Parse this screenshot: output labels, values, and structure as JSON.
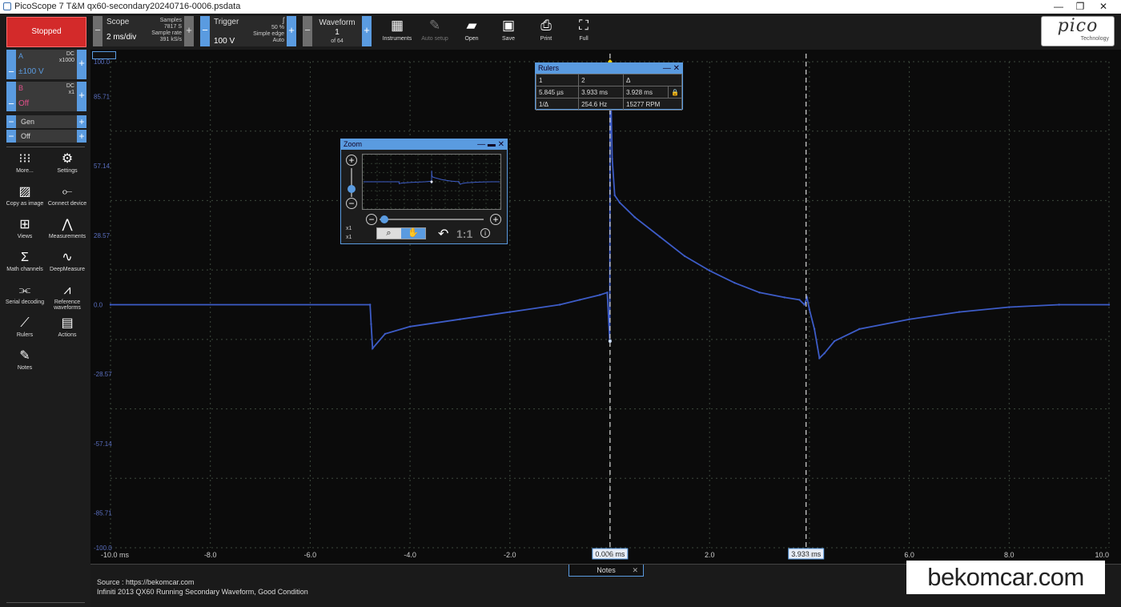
{
  "window": {
    "title": "PicoScope 7 T&M qx60-secondary20240716-0006.psdata",
    "min": "—",
    "restore": "❐",
    "close": "✕"
  },
  "toolbar": {
    "run_state": "Stopped",
    "scope": {
      "label": "Scope",
      "value": "2 ms/div",
      "samples_label": "Samples",
      "samples": "7817 S",
      "rate_label": "Sample rate",
      "rate": "391 kS/s"
    },
    "trigger": {
      "label": "Trigger",
      "value": "100 V",
      "level": "50 %",
      "type": "Simple edge",
      "mode": "Auto",
      "glyph": "ʃ"
    },
    "waveform": {
      "label": "Waveform",
      "value": "1",
      "of": "of 64"
    },
    "buttons": [
      {
        "label": "Instruments",
        "glyph": "▦"
      },
      {
        "label": "Auto setup",
        "glyph": "✎"
      },
      {
        "label": "Open",
        "glyph": "▰"
      },
      {
        "label": "Save",
        "glyph": "▣"
      },
      {
        "label": "Print",
        "glyph": "⎙"
      },
      {
        "label": "Full",
        "glyph": "⛶"
      }
    ],
    "logo": {
      "text": "pico",
      "sub": "Technology"
    }
  },
  "sidebar": {
    "ch_a": {
      "name": "A",
      "coupling": "DC",
      "probe": "x1000",
      "range": "±100 V"
    },
    "ch_b": {
      "name": "B",
      "coupling": "DC",
      "probe": "x1",
      "range": "Off"
    },
    "gen": {
      "label": "Gen",
      "value": "Off"
    },
    "tools": [
      {
        "label": "More...",
        "icon": "more-icon",
        "glyph": "⁝⁝⁝"
      },
      {
        "label": "Settings",
        "icon": "gear-icon",
        "glyph": "⚙"
      },
      {
        "label": "Copy as image",
        "icon": "image-icon",
        "glyph": "▨"
      },
      {
        "label": "Connect device",
        "icon": "usb-icon",
        "glyph": "⟜"
      },
      {
        "label": "Views",
        "icon": "views-icon",
        "glyph": "⊞"
      },
      {
        "label": "Measurements",
        "icon": "measure-icon",
        "glyph": "⋀"
      },
      {
        "label": "Math channels",
        "icon": "sigma-icon",
        "glyph": "Σ"
      },
      {
        "label": "DeepMeasure",
        "icon": "deepmeasure-icon",
        "glyph": "∿"
      },
      {
        "label": "Serial decoding",
        "icon": "serial-icon",
        "glyph": "⫘"
      },
      {
        "label": "Reference waveforms",
        "icon": "reference-icon",
        "glyph": "⩘"
      },
      {
        "label": "Rulers",
        "icon": "ruler-icon",
        "glyph": "⟋"
      },
      {
        "label": "Actions",
        "icon": "clapper-icon",
        "glyph": "▤"
      },
      {
        "label": "Notes",
        "icon": "notes-icon",
        "glyph": "✎"
      }
    ]
  },
  "scope_view": {
    "channel_label": "V",
    "y_labels": [
      "100.0",
      "85.71",
      "57.14",
      "28.57",
      "0.0",
      "-28.57",
      "-57.14",
      "-85.71",
      "-100.0"
    ],
    "x_labels": [
      "-10.0 ms",
      "-8.0",
      "-6.0",
      "-4.0",
      "-2.0",
      "0.0",
      "2.0",
      "4.0",
      "6.0",
      "8.0",
      "10.0"
    ],
    "ruler1_label": "0.006 ms",
    "ruler2_label": "3.933 ms",
    "trace_color": "#3d5cc7",
    "ruler_color": "#d9d9d9"
  },
  "rulers_panel": {
    "title": "Rulers",
    "minimize": "—",
    "close": "✕",
    "headers": [
      "1",
      "2",
      "Δ"
    ],
    "values": [
      "5.845 µs",
      "3.933 ms",
      "3.928 ms"
    ],
    "freq_label": "1/Δ",
    "freq": "254.6 Hz",
    "rpm": "15277 RPM"
  },
  "zoom_panel": {
    "title": "Zoom",
    "controls": "— ▬ ✕",
    "zoom_x": "x1",
    "zoom_y": "x1",
    "plus": "+",
    "minus": "−",
    "mode_zoom_glyph": "⌕",
    "mode_hand_glyph": "✋",
    "undo_glyph": "↶",
    "ratio": "1:1",
    "info": "i"
  },
  "notes": {
    "tab": "Notes",
    "close": "✕",
    "line1": "Source : https://bekomcar.com",
    "line2": "Infiniti 2013 QX60 Running Secondary Waveform, Good Condition"
  },
  "watermark": "bekomcar.com",
  "chart_data": {
    "type": "line",
    "xlabel": "",
    "ylabel": "V",
    "xlim": [
      -10,
      10
    ],
    "ylim": [
      -100,
      100
    ],
    "grid": true,
    "series": [
      {
        "name": "A",
        "color": "#3d5cc7",
        "x": [
          -10,
          -4.8,
          -4.78,
          -4.75,
          -4.5,
          -4.0,
          -3.0,
          -2.0,
          -1.0,
          -0.6,
          -0.2,
          -0.05,
          0.0,
          0.01,
          0.02,
          0.05,
          0.1,
          0.2,
          0.5,
          1.0,
          1.5,
          2.0,
          2.5,
          3.0,
          3.5,
          3.8,
          3.9,
          3.95,
          4.0,
          4.1,
          4.2,
          4.3,
          4.5,
          5.0,
          6.0,
          7.0,
          8.0,
          9.0,
          10.0
        ],
        "y": [
          0,
          0,
          -8,
          -18,
          -12,
          -9,
          -6,
          -3,
          0,
          2,
          4,
          5,
          -15,
          100,
          90,
          60,
          45,
          42,
          36,
          28,
          20,
          14,
          9,
          5,
          3,
          2,
          0,
          3,
          -2,
          -10,
          -22,
          -20,
          -15,
          -10,
          -6,
          -3,
          -1,
          0,
          0
        ]
      }
    ],
    "rulers_ms": [
      0.006,
      3.933
    ]
  }
}
